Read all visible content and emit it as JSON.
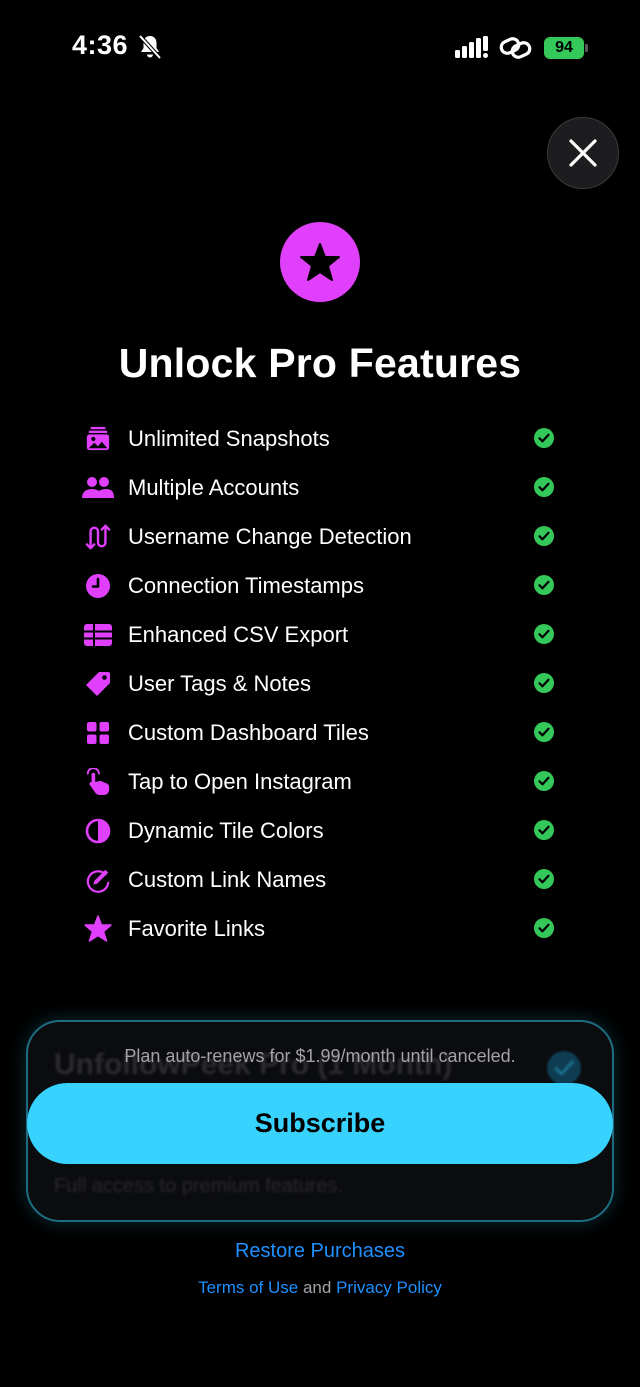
{
  "status_bar": {
    "time": "4:36",
    "battery": "94",
    "icons": [
      "bell-slash-icon",
      "signal-icon",
      "link-icon",
      "battery-icon"
    ]
  },
  "colors": {
    "accent": "#e040fb",
    "cta": "#38d2ff",
    "check": "#34c759",
    "link": "#1e90ff"
  },
  "header": {
    "icon": "star-icon",
    "title": "Unlock Pro Features"
  },
  "features": [
    {
      "label": "Unlimited Snapshots",
      "icon": "photo-stack-icon"
    },
    {
      "label": "Multiple Accounts",
      "icon": "two-people-icon"
    },
    {
      "label": "Username Change Detection",
      "icon": "swap-arrows-icon"
    },
    {
      "label": "Connection Timestamps",
      "icon": "clock-icon"
    },
    {
      "label": "Enhanced CSV Export",
      "icon": "table-icon"
    },
    {
      "label": "User Tags & Notes",
      "icon": "tag-icon"
    },
    {
      "label": "Custom Dashboard Tiles",
      "icon": "grid-icon"
    },
    {
      "label": "Tap to Open Instagram",
      "icon": "tap-hand-icon"
    },
    {
      "label": "Dynamic Tile Colors",
      "icon": "half-circle-icon"
    },
    {
      "label": "Custom Link Names",
      "icon": "link-edit-icon"
    },
    {
      "label": "Favorite Links",
      "icon": "star-icon"
    }
  ],
  "plan": {
    "name": "UnfollowPeek Pro (1 Month)",
    "description": "Full access to premium features.",
    "renew_note": "Plan auto-renews for $1.99/month until canceled."
  },
  "actions": {
    "subscribe": "Subscribe",
    "restore": "Restore Purchases",
    "terms": "Terms of Use",
    "and": "and",
    "privacy": "Privacy Policy"
  }
}
